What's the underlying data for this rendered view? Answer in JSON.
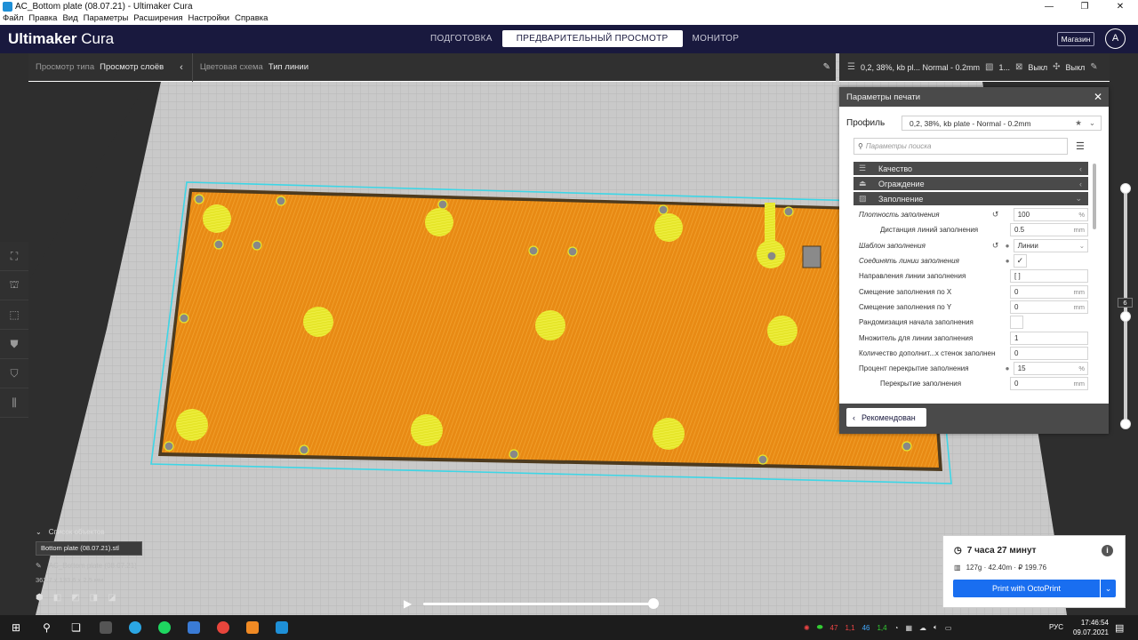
{
  "window": {
    "title": "AC_Bottom plate (08.07.21) - Ultimaker Cura",
    "controls": [
      "—",
      "❐",
      "✕"
    ]
  },
  "menu": [
    "Файл",
    "Правка",
    "Вид",
    "Параметры",
    "Расширения",
    "Настройки",
    "Справка"
  ],
  "header": {
    "brand_bold": "Ultimaker",
    "brand_light": "Cura",
    "stages": [
      "ПОДГОТОВКА",
      "ПРЕДВАРИТЕЛЬНЫЙ ПРОСМОТР",
      "МОНИТОР"
    ],
    "active_stage": 1,
    "shop": "Магазин",
    "account_initial": "A"
  },
  "viewbar": {
    "view_type_label": "Просмотр типа",
    "view_type_value": "Просмотр слоёв",
    "color_scheme_label": "Цветовая схема",
    "color_scheme_value": "Тип линии"
  },
  "profilebar": {
    "profile": "0,2, 38%, kb pl... Normal - 0.2mm",
    "support_value": "1...",
    "adhesion_1": "Выкл",
    "adhesion_2": "Выкл"
  },
  "settings_panel": {
    "title": "Параметры печати",
    "profile_label": "Профиль",
    "profile_value": "0,2, 38%, kb plate - Normal - 0.2mm",
    "search_placeholder": "Параметры поиска",
    "categories": [
      {
        "label": "Качество",
        "expanded": false
      },
      {
        "label": "Ограждение",
        "expanded": false
      },
      {
        "label": "Заполнение",
        "expanded": true
      }
    ],
    "rows": [
      {
        "name": "Плотность заполнения",
        "value": "100",
        "unit": "%"
      },
      {
        "name": "Дистанция линий заполнения",
        "value": "0.5",
        "unit": "mm"
      },
      {
        "name": "Шаблон заполнения",
        "value": "Линии",
        "unit": "⌄"
      },
      {
        "name": "Соединять линии заполнения",
        "value": "✓",
        "unit": ""
      },
      {
        "name": "Направления линии заполнения",
        "value": "[ ]",
        "unit": ""
      },
      {
        "name": "Смещение заполнения по X",
        "value": "0",
        "unit": "mm"
      },
      {
        "name": "Смещение заполнения по Y",
        "value": "0",
        "unit": "mm"
      },
      {
        "name": "Рандомизация начала заполнения",
        "value": "",
        "unit": ""
      },
      {
        "name": "Множитель для линии заполнения",
        "value": "1",
        "unit": ""
      },
      {
        "name": "Количество дополнит...х стенок заполнения",
        "value": "0",
        "unit": ""
      },
      {
        "name": "Процент перекрытие заполнения",
        "value": "15",
        "unit": "%"
      },
      {
        "name": "Перекрытие заполнения",
        "value": "0",
        "unit": "mm"
      }
    ],
    "recommended_button": "Рекомендован"
  },
  "layer_slider": {
    "current_layer": "6"
  },
  "object_list": {
    "title": "Список объектов",
    "file": "Bottom plate (08.07.21).stl",
    "object_name": "AC_Bottom plate (08.07.21)",
    "dimensions": "362.7 x 133.6 x 2.5 мм"
  },
  "print_action": {
    "time": "7 часа 27 минут",
    "material": "127g · 42.40m · ₽ 199.76",
    "button": "Print with OctoPrint"
  },
  "taskbar": {
    "tray_values": [
      "47",
      "1,1",
      "46",
      "1,4"
    ],
    "language": "РУС",
    "time": "17:46:54",
    "date": "09.07.2021"
  }
}
